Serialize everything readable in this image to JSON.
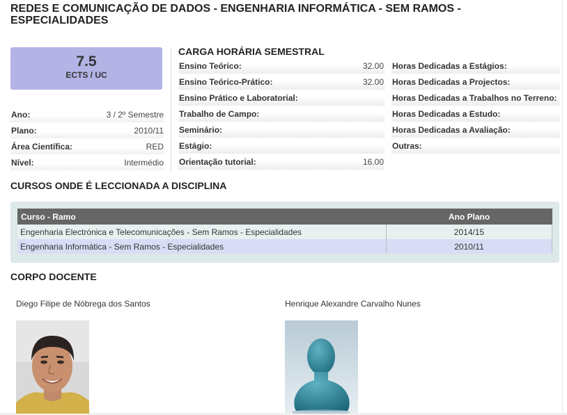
{
  "page": {
    "title": "REDES E COMUNICAÇÃO DE DADOS - ENGENHARIA INFORMÁTICA - SEM RAMOS - ESPECIALIDADES"
  },
  "ects": {
    "value": "7.5",
    "label": "ECTS / UC"
  },
  "info": [
    {
      "label": "Ano:",
      "value": "3 / 2º Semestre"
    },
    {
      "label": "Plano:",
      "value": "2010/11"
    },
    {
      "label": "Área Científica:",
      "value": "RED"
    },
    {
      "label": "Nível:",
      "value": "Intermédio"
    }
  ],
  "workload": {
    "title": "CARGA HORÁRIA SEMESTRAL",
    "left": [
      {
        "label": "Ensino Teórico:",
        "value": "32.00"
      },
      {
        "label": "Ensino Teórico-Prático:",
        "value": "32.00"
      },
      {
        "label": "Ensino Prático e Laboratorial:",
        "value": ""
      },
      {
        "label": "Trabalho de Campo:",
        "value": ""
      },
      {
        "label": "Seminário:",
        "value": ""
      },
      {
        "label": "Estágio:",
        "value": ""
      },
      {
        "label": "Orientação tutorial:",
        "value": "16.00"
      }
    ],
    "right": [
      {
        "label": "Horas Dedicadas a Estágios:",
        "value": ""
      },
      {
        "label": "Horas Dedicadas a Projectos:",
        "value": ""
      },
      {
        "label": "Horas Dedicadas a Trabalhos no Terreno:",
        "value": ""
      },
      {
        "label": "Horas Dedicadas a Estudo:",
        "value": ""
      },
      {
        "label": "Horas Dedicadas a Avaliação:",
        "value": ""
      },
      {
        "label": "Outras:",
        "value": ""
      }
    ]
  },
  "courses": {
    "title": "CURSOS ONDE É LECCIONADA A DISCIPLINA",
    "headers": {
      "course": "Curso - Ramo",
      "plan": "Ano Plano"
    },
    "rows": [
      {
        "course": "Engenharia Electrónica e Telecomunicações - Sem Ramos - Especialidades",
        "plan": "2014/15"
      },
      {
        "course": "Engenharia Informática - Sem Ramos - Especialidades",
        "plan": "2010/11"
      }
    ]
  },
  "faculty": {
    "title": "CORPO DOCENTE",
    "members": [
      {
        "name": "Diego Filipe de Nóbrega dos Santos",
        "photo": "person-photo"
      },
      {
        "name": "Henrique Alexandre Carvalho Nunes",
        "photo": "placeholder-avatar"
      }
    ]
  },
  "colors": {
    "ects_box": "#b3b3e6",
    "table_header": "#666666",
    "row_highlight": "#d8ddf5",
    "courses_panel": "#dde8e8",
    "avatar_teal": "#3a8c9e"
  }
}
